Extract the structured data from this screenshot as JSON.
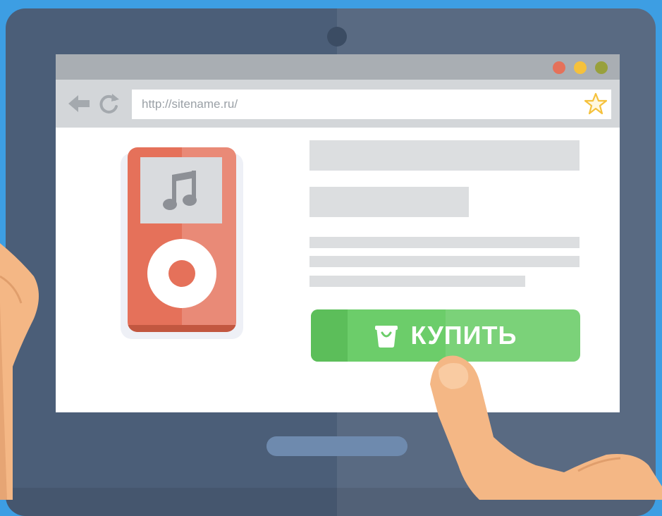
{
  "browser": {
    "url": "http://sitename.ru/",
    "window_controls": [
      "close",
      "minimize",
      "maximize"
    ]
  },
  "product": {
    "icon": "music-player-icon",
    "screen_icon": "music-note-icon"
  },
  "cta": {
    "label": "КУПИТЬ",
    "icon": "shopping-bag-icon"
  },
  "colors": {
    "background": "#3d9ee3",
    "tablet": "#4b5e78",
    "player": "#e5715a",
    "button": "#6ccd6a",
    "star": "#f5c13c"
  }
}
